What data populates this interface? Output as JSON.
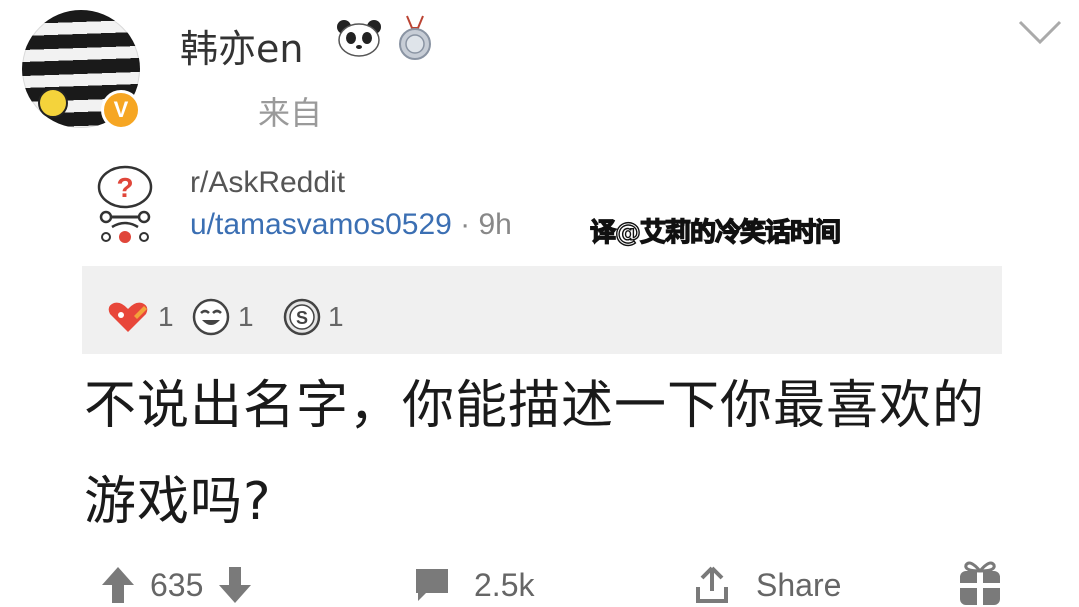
{
  "header": {
    "username": "韩亦en",
    "source_label": "来自",
    "verified_badge": "V"
  },
  "embed": {
    "subreddit": "r/AskReddit",
    "author": "u/tamasvamos0529",
    "separator": "·",
    "time": "9h",
    "watermark": "译@艾莉的冷笑话时间",
    "awards": [
      {
        "icon": "rocket-heart-award-icon",
        "count": "1"
      },
      {
        "icon": "laughing-face-award-icon",
        "count": "1"
      },
      {
        "icon": "silver-coin-award-icon",
        "count": "1"
      }
    ],
    "title": "不说出名字，你能描述一下你最喜欢的游戏吗?"
  },
  "actions": {
    "votes": "635",
    "comments": "2.5k",
    "share": "Share"
  }
}
